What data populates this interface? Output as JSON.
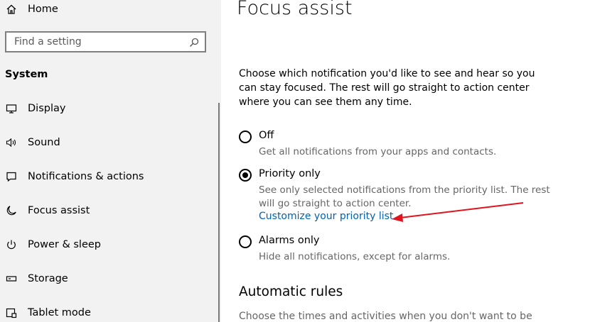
{
  "sidebar": {
    "home_label": "Home",
    "search_placeholder": "Find a setting",
    "section_title": "System",
    "items": [
      {
        "label": "Display",
        "icon": "display-icon"
      },
      {
        "label": "Sound",
        "icon": "sound-icon"
      },
      {
        "label": "Notifications & actions",
        "icon": "notifications-icon"
      },
      {
        "label": "Focus assist",
        "icon": "moon-icon"
      },
      {
        "label": "Power & sleep",
        "icon": "power-icon"
      },
      {
        "label": "Storage",
        "icon": "storage-icon"
      },
      {
        "label": "Tablet mode",
        "icon": "tablet-icon"
      }
    ]
  },
  "main": {
    "title": "Focus assist",
    "description": "Choose which notification you'd like to see and hear so you can stay focused. The rest will go straight to action center where you can see them any time.",
    "options": [
      {
        "label": "Off",
        "desc": [
          "Get all notifications from your apps and contacts."
        ],
        "selected": false
      },
      {
        "label": "Priority only",
        "desc": [
          "See only selected notifications from the priority list. The rest",
          "will go straight to action center."
        ],
        "selected": true,
        "link": "Customize your priority list"
      },
      {
        "label": "Alarms only",
        "desc": [
          "Hide all notifications, except for alarms."
        ],
        "selected": false
      }
    ],
    "automatic_rules_title": "Automatic rules",
    "automatic_rules_desc": "Choose the times and activities when you don't want to be"
  },
  "colors": {
    "accent": "#0063b1",
    "sidebar_bg": "#f2f2f2",
    "annotation_arrow": "#e0141e"
  }
}
